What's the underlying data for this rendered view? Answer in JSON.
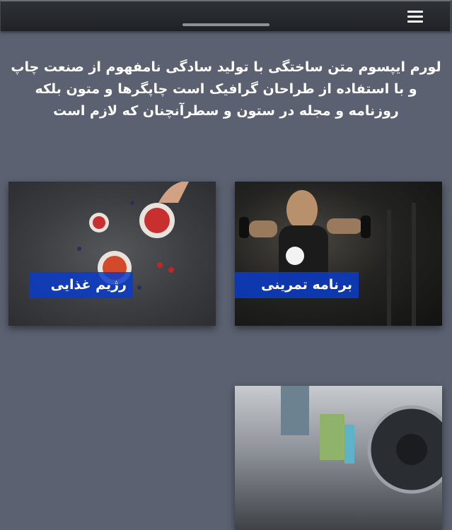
{
  "header": {
    "menu_icon": "hamburger-menu-icon"
  },
  "intro": {
    "text": "لورم ایپسوم متن ساختگی با تولید سادگی نامفهوم از صنعت چاپ و با استفاده از طراحان گرافیک است چاپگرها و متون بلکه روزنامه و مجله در ستون و سطرآنچنان که لازم است"
  },
  "cards": [
    {
      "label": "برنامه تمرینی"
    },
    {
      "label": "رژیم غذایی"
    },
    {
      "label": ""
    }
  ],
  "colors": {
    "background": "#5b6170",
    "topbar": "#25282c",
    "label_bg": "#0a3cc8"
  }
}
